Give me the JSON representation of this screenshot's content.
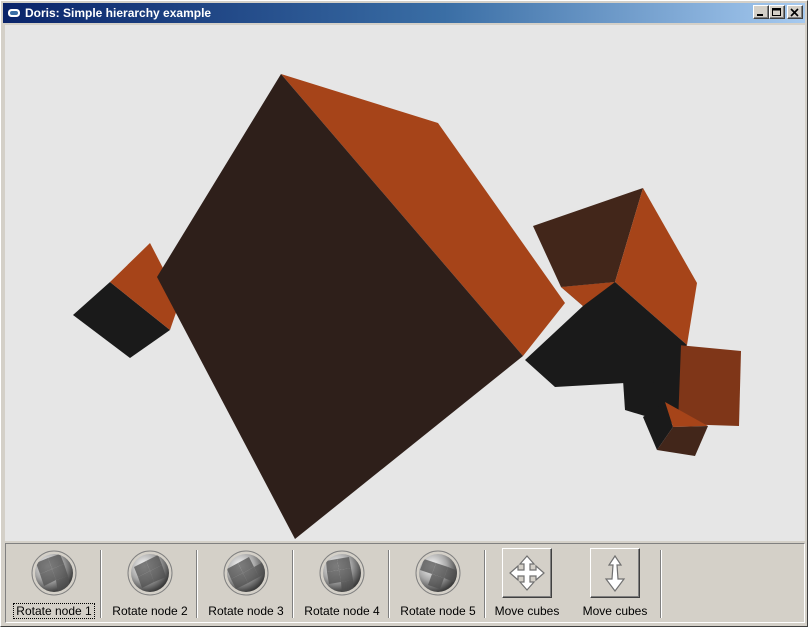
{
  "window": {
    "title": "Doris: Simple hierarchy example",
    "minimize_label": "_",
    "maximize_label": "□",
    "close_label": "×"
  },
  "viewport": {
    "background": "#e6e6e6",
    "scene": "cube-hierarchy-3d"
  },
  "toolbar": {
    "tools": [
      {
        "label": "Rotate node 1",
        "icon": "rotate-sphere-icon",
        "focused": true
      },
      {
        "label": "Rotate node 2",
        "icon": "rotate-sphere-icon",
        "focused": false
      },
      {
        "label": "Rotate node 3",
        "icon": "rotate-sphere-icon",
        "focused": false
      },
      {
        "label": "Rotate node 4",
        "icon": "rotate-sphere-icon",
        "focused": false
      },
      {
        "label": "Rotate node 5",
        "icon": "rotate-sphere-icon",
        "focused": false
      },
      {
        "label": "Move cubes",
        "icon": "move-four-way-icon",
        "focused": false
      },
      {
        "label": "Move cubes",
        "icon": "move-vertical-icon",
        "focused": false
      }
    ]
  },
  "colors": {
    "title_bar_start": "#0a246a",
    "title_bar_end": "#a6caf0",
    "cube_orange": "#a64419",
    "cube_dark": "#2e1f1a",
    "cube_black": "#1a1a1a",
    "cube_brown": "#42261a"
  }
}
